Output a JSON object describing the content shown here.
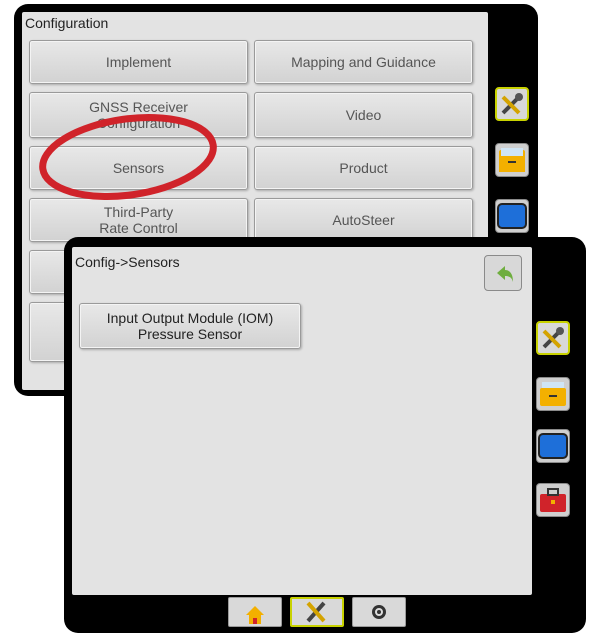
{
  "back_screen": {
    "title": "Configuration",
    "buttons": [
      {
        "label": "Implement",
        "line2": ""
      },
      {
        "label": "Mapping and Guidance",
        "line2": ""
      },
      {
        "label": "GNSS Receiver",
        "line2": "Configuration"
      },
      {
        "label": "Video",
        "line2": ""
      },
      {
        "label": "Sensors",
        "line2": ""
      },
      {
        "label": "Product",
        "line2": ""
      },
      {
        "label": "Third-Party",
        "line2": "Rate Control"
      },
      {
        "label": "AutoSteer",
        "line2": ""
      }
    ],
    "side_tabs": [
      "tools-icon",
      "folder-icon",
      "screen-icon"
    ]
  },
  "front_screen": {
    "breadcrumb": "Config->Sensors",
    "sensor_button": {
      "line1": "Input Output Module (IOM)",
      "line2": "Pressure Sensor"
    },
    "side_tabs": [
      "tools-icon",
      "folder-icon",
      "screen-icon",
      "toolbox-icon"
    ],
    "bottom_nav": [
      "home-icon",
      "tools-icon",
      "camera-icon"
    ]
  },
  "colors": {
    "highlight_circle": "#d0232a",
    "active_border": "#c8d200",
    "back_arrow": "#6fae3f"
  }
}
